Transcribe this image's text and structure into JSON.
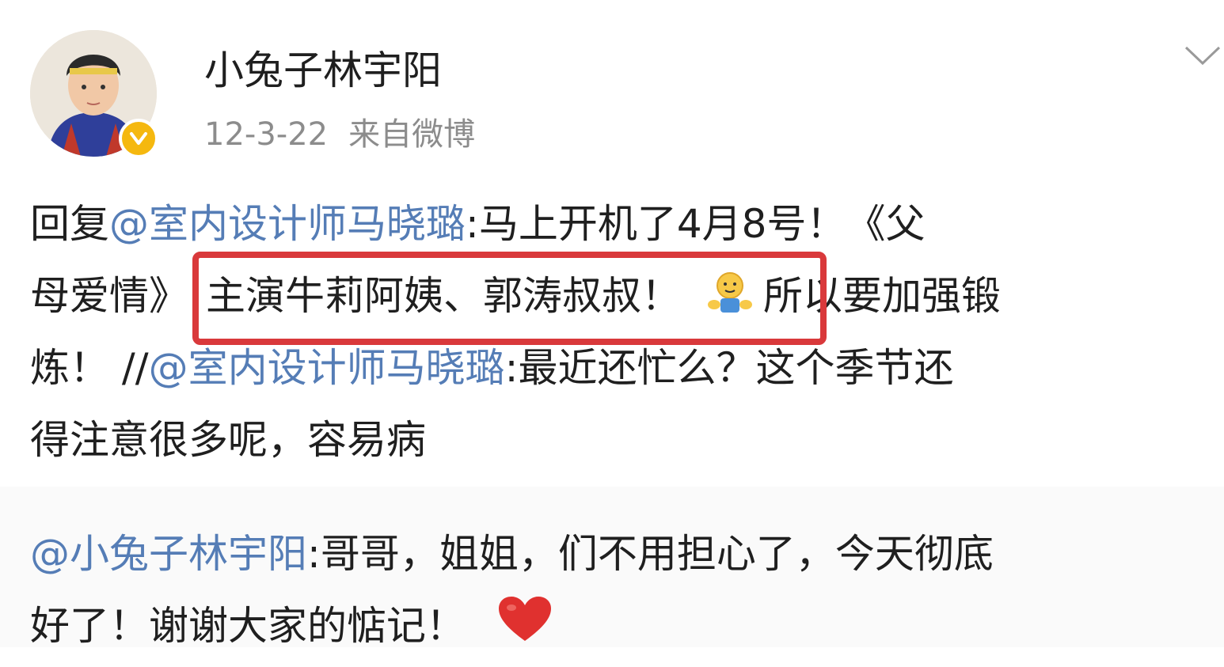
{
  "post": {
    "author": "小兔子林宇阳",
    "time": "12-3-22",
    "source": "来自微博",
    "lines": [
      {
        "pre": "回复",
        "mention": "@室内设计师马晓璐",
        "post": ":马上开机了4月8号！《父"
      },
      {
        "pre": "母爱情》",
        "highlight": "主演牛莉阿姨、郭涛叔叔！",
        "post": "所以要加强锻"
      },
      {
        "pre": "炼！ //",
        "mention": "@室内设计师马晓璐",
        "post": ":最近还忙么？这个季节还"
      },
      {
        "pre": "得注意很多呢，容易病"
      }
    ],
    "emoji": "hug-emoji"
  },
  "reply": {
    "lines": [
      {
        "mention": "@小兔子林宇阳",
        "post": ":哥哥，姐姐，们不用担心了，今天彻底"
      },
      {
        "pre": "好了！谢谢大家的惦记！"
      }
    ],
    "emoji": "heart-emoji"
  },
  "colors": {
    "mention": "#557db6",
    "highlight_border": "#d9393b",
    "verified_badge": "#f5b80f",
    "heart": "#e0312f"
  }
}
